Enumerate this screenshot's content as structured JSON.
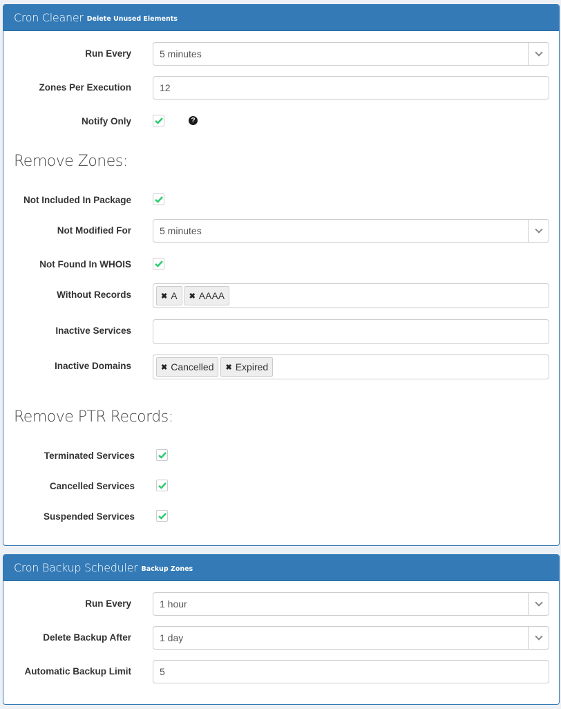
{
  "cleaner": {
    "title": "Cron Cleaner",
    "subtitle": "Delete Unused Elements",
    "run_every": {
      "label": "Run Every",
      "value": "5 minutes"
    },
    "zones_per_execution": {
      "label": "Zones Per Execution",
      "value": "12"
    },
    "notify_only": {
      "label": "Notify Only",
      "checked": true,
      "help_icon": "question-circle-icon"
    },
    "remove_zones": {
      "heading": "Remove Zones:",
      "not_included_in_package": {
        "label": "Not Included In Package",
        "checked": true
      },
      "not_modified_for": {
        "label": "Not Modified For",
        "value": "5 minutes"
      },
      "not_found_in_whois": {
        "label": "Not Found In WHOIS",
        "checked": true
      },
      "without_records": {
        "label": "Without Records",
        "tags": [
          "A",
          "AAAA"
        ]
      },
      "inactive_services": {
        "label": "Inactive Services",
        "tags": []
      },
      "inactive_domains": {
        "label": "Inactive Domains",
        "tags": [
          "Cancelled",
          "Expired"
        ]
      }
    },
    "remove_ptr": {
      "heading": "Remove PTR Records:",
      "terminated_services": {
        "label": "Terminated Services",
        "checked": true
      },
      "cancelled_services": {
        "label": "Cancelled Services",
        "checked": true
      },
      "suspended_services": {
        "label": "Suspended Services",
        "checked": true
      }
    }
  },
  "backup": {
    "title": "Cron Backup Scheduler",
    "subtitle": "Backup Zones",
    "run_every": {
      "label": "Run Every",
      "value": "1 hour"
    },
    "delete_backup_after": {
      "label": "Delete Backup After",
      "value": "1 day"
    },
    "automatic_backup_limit": {
      "label": "Automatic Backup Limit",
      "value": "5"
    }
  },
  "colors": {
    "primary": "#337ab7",
    "check": "#2ecc71",
    "background": "#edf0f5"
  }
}
